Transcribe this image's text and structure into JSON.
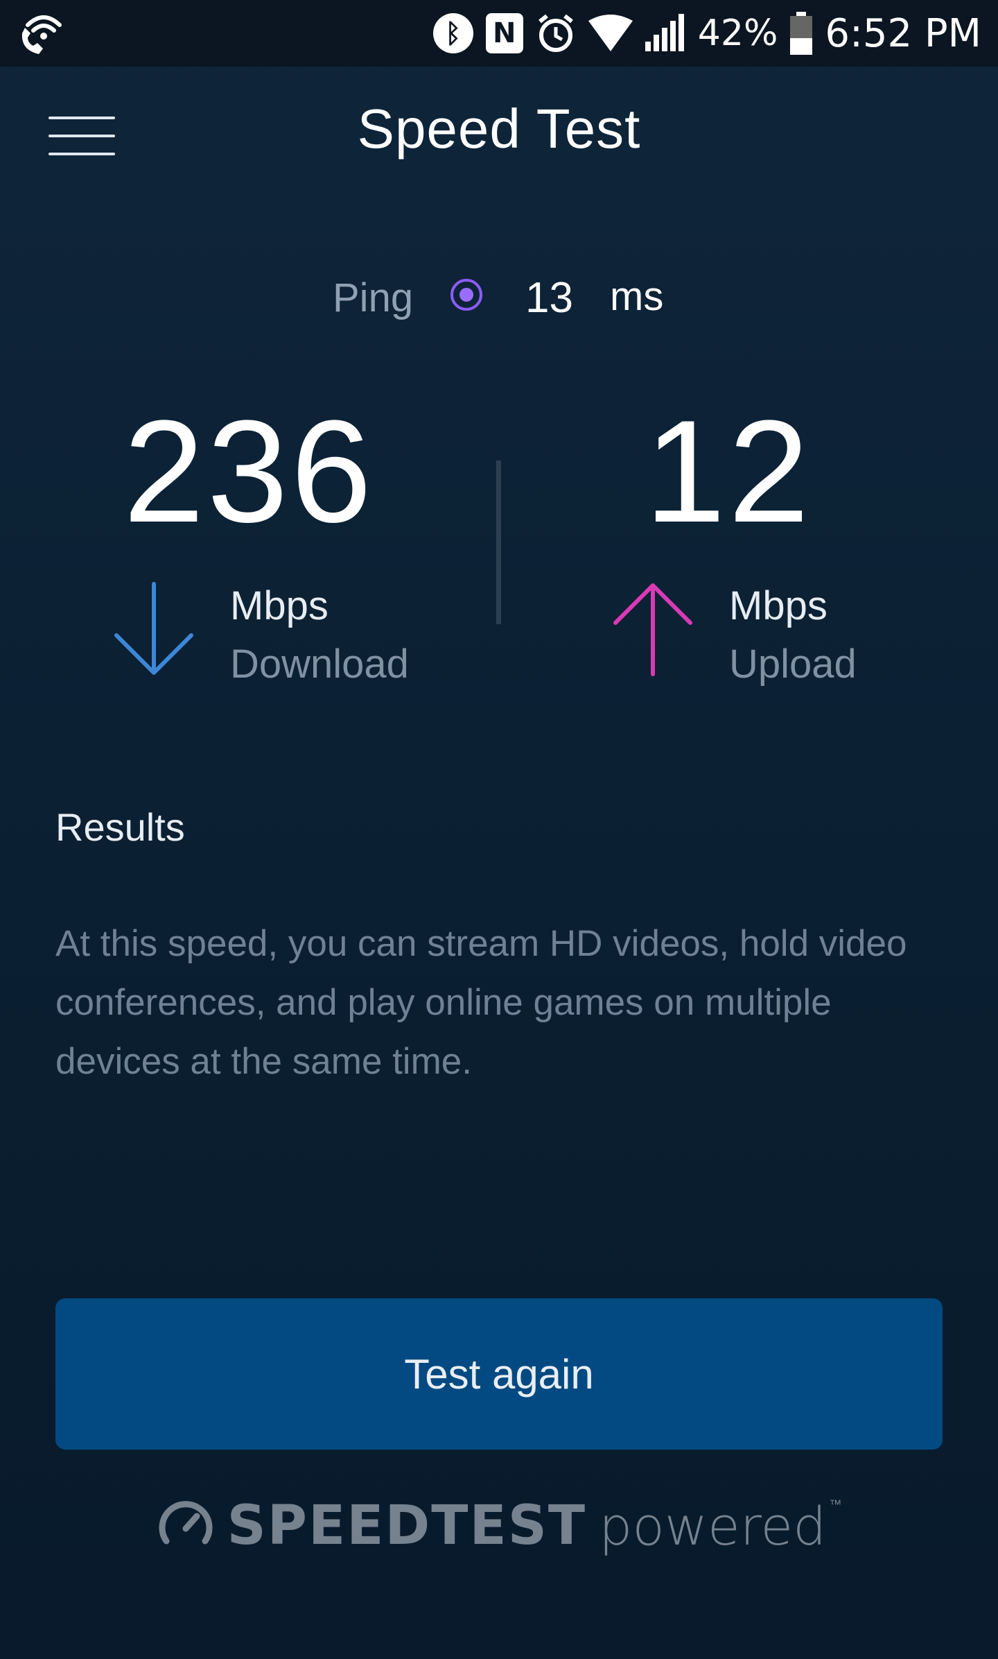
{
  "status_bar": {
    "icons": [
      "wifi-calling-icon",
      "bluetooth-icon",
      "nfc-icon",
      "alarm-icon",
      "wifi-icon",
      "signal-icon",
      "battery-icon"
    ],
    "battery_percent": "42%",
    "battery_level": 0.42,
    "time": "6:52 PM"
  },
  "header": {
    "title": "Speed Test",
    "menu_icon": "hamburger-menu-icon"
  },
  "ping": {
    "label": "Ping",
    "value": "13",
    "unit": "ms",
    "color": "#9b6dff"
  },
  "download": {
    "value": "236",
    "unit": "Mbps",
    "label": "Download",
    "icon": "down-arrow-icon",
    "color": "#3d87d6"
  },
  "upload": {
    "value": "12",
    "unit": "Mbps",
    "label": "Upload",
    "icon": "up-arrow-icon",
    "color": "#d93ab5"
  },
  "results": {
    "heading": "Results",
    "body": "At this speed, you can stream HD videos, hold video conferences, and play online games on multiple devices at the same time."
  },
  "actions": {
    "test_again_label": "Test again"
  },
  "footer": {
    "logo_word": "SPEEDTEST",
    "logo_powered": "powered",
    "logo_tm": "™"
  },
  "colors": {
    "background": "#0d2235",
    "button": "#044a82",
    "status_bar": "#0b1622"
  }
}
